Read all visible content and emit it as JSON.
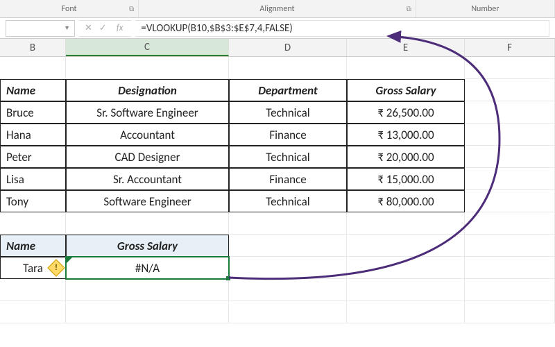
{
  "ribbon": {
    "groups": [
      "Font",
      "Alignment",
      "Number"
    ]
  },
  "formula_bar": {
    "namebox": "",
    "fx_label": "fx",
    "formula": "=VLOOKUP(B10,$B$3:$E$7,4,FALSE)"
  },
  "columns": [
    "B",
    "C",
    "D",
    "E",
    "F"
  ],
  "selected_column": "C",
  "table": {
    "headers": [
      "Name",
      "Designation",
      "Department",
      "Gross Salary"
    ],
    "rows": [
      {
        "name": "Bruce",
        "designation": "Sr. Software Engineer",
        "department": "Technical",
        "salary": "₹ 26,500.00"
      },
      {
        "name": "Hana",
        "designation": "Accountant",
        "department": "Finance",
        "salary": "₹ 13,000.00"
      },
      {
        "name": "Peter",
        "designation": "CAD Designer",
        "department": "Technical",
        "salary": "₹ 20,000.00"
      },
      {
        "name": "Lisa",
        "designation": "Sr. Accountant",
        "department": "Finance",
        "salary": "₹ 15,000.00"
      },
      {
        "name": "Tony",
        "designation": "Software Engineer",
        "department": "Technical",
        "salary": "₹ 80,000.00"
      }
    ]
  },
  "lookup": {
    "headers": [
      "Name",
      "Gross Salary"
    ],
    "name": "Tara",
    "result": "#N/A"
  },
  "error_tooltip": "!"
}
